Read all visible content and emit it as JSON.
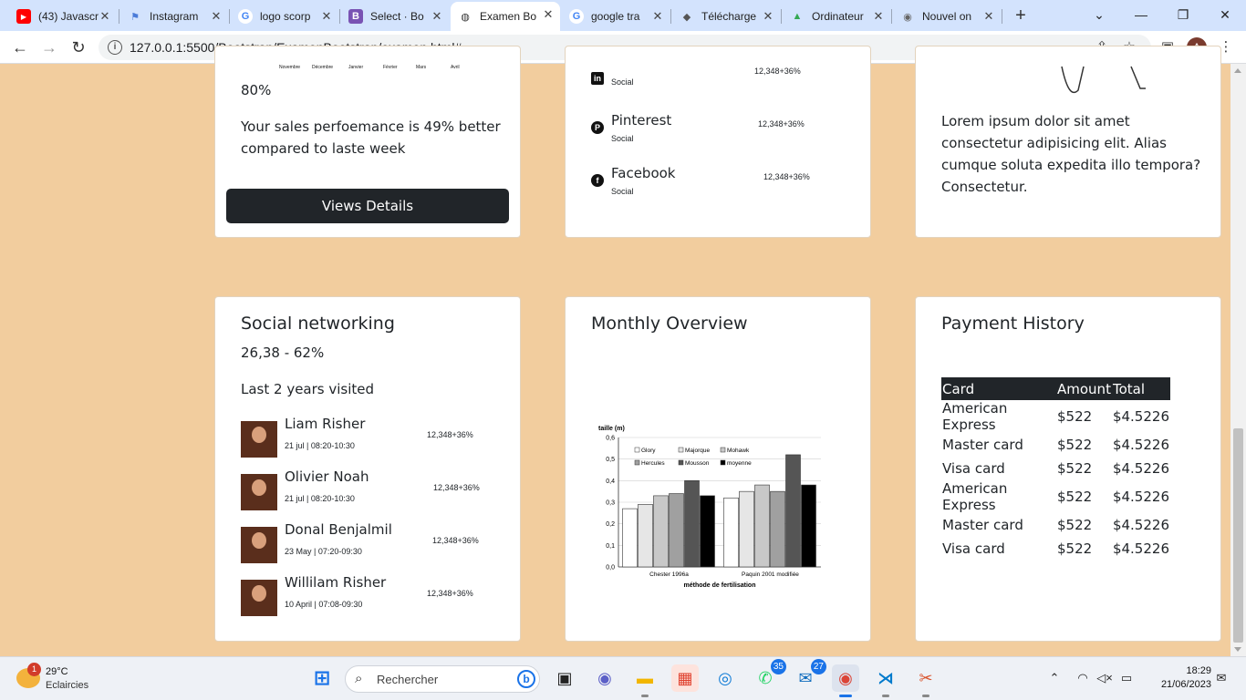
{
  "browser": {
    "tabs": [
      {
        "label": "(43) Javascr",
        "icon": "youtube-icon",
        "color": "#ff0000",
        "glyph": "▶"
      },
      {
        "label": "Instagram",
        "icon": "flag-icon",
        "color": "#4a7bd8",
        "glyph": "⚑"
      },
      {
        "label": "logo scorp",
        "icon": "google-icon",
        "color": "#4285f4",
        "glyph": "G"
      },
      {
        "label": "Select · Bo",
        "icon": "bootstrap-icon",
        "color": "#7952b3",
        "glyph": "B"
      },
      {
        "label": "Examen Bo",
        "icon": "globe-icon",
        "color": "#333333",
        "glyph": "◍",
        "active": true
      },
      {
        "label": "google tra",
        "icon": "google-icon",
        "color": "#4285f4",
        "glyph": "G"
      },
      {
        "label": "Télécharge",
        "icon": "diamond-icon",
        "color": "#555555",
        "glyph": "◆"
      },
      {
        "label": "Ordinateur",
        "icon": "drive-icon",
        "color": "#34a853",
        "glyph": "▲"
      },
      {
        "label": "Nouvel on",
        "icon": "chrome-icon",
        "color": "#666666",
        "glyph": "◉"
      }
    ],
    "url": "127.0.0.1:5500/Bootstrap/ExamenBootstrap/examen.html#",
    "profile_initial": "A"
  },
  "top_left_card": {
    "chart_months": [
      "Novembre",
      "Décembre",
      "Janvier",
      "Février",
      "Mars",
      "Avril"
    ],
    "percent": "80%",
    "sales_text": "Your sales perfoemance is 49% better compared to laste week",
    "button_label": "Views Details"
  },
  "top_mid_card": {
    "rows": [
      {
        "name": "",
        "sub": "Social",
        "value": "12,348+36%",
        "icon": "linkedin-icon",
        "glyph": "in"
      },
      {
        "name": "Pinterest",
        "sub": "Social",
        "value": "12,348+36%",
        "icon": "pinterest-icon",
        "glyph": "P"
      },
      {
        "name": "Facebook",
        "sub": "Social",
        "value": "12,348+36%",
        "icon": "facebook-icon",
        "glyph": "f"
      }
    ]
  },
  "top_right_card": {
    "text": "Lorem ipsum dolor sit amet consectetur adipisicing elit. Alias cumque soluta expedita illo tempora? Consectetur."
  },
  "social_card": {
    "title": "Social networking",
    "stat": "26,38 - 62%",
    "subtitle": "Last 2 years visited",
    "people": [
      {
        "name": "Liam Risher",
        "date": "21 jul | 08:20-10:30",
        "value": "12,348+36%"
      },
      {
        "name": "Olivier Noah",
        "date": "21 jul | 08:20-10:30",
        "value": "12,348+36%"
      },
      {
        "name": "Donal Benjalmil",
        "date": "23 May | 07:20-09:30",
        "value": "12,348+36%"
      },
      {
        "name": "Willilam Risher",
        "date": "10 April | 07:08-09:30",
        "value": "12,348+36%"
      }
    ]
  },
  "monthly_card": {
    "title": "Monthly Overview"
  },
  "chart_data": {
    "type": "bar",
    "ylabel": "taille (m)",
    "xlabel": "méthode de fertilisation",
    "categories": [
      "Chester 1996a",
      "Paquin 2001 modifiée"
    ],
    "ylim": [
      0,
      0.6
    ],
    "yticks": [
      "0,0",
      "0,1",
      "0,2",
      "0,3",
      "0,4",
      "0,5",
      "0,6"
    ],
    "series": [
      {
        "name": "Glory",
        "values": [
          0.27,
          0.32
        ],
        "color": "#ffffff"
      },
      {
        "name": "Majorque",
        "values": [
          0.29,
          0.35
        ],
        "color": "#e6e6e6"
      },
      {
        "name": "Mohawk",
        "values": [
          0.33,
          0.38
        ],
        "color": "#c8c8c8"
      },
      {
        "name": "Hercules",
        "values": [
          0.34,
          0.35
        ],
        "color": "#a0a0a0"
      },
      {
        "name": "Mousson",
        "values": [
          0.4,
          0.52
        ],
        "color": "#555555"
      },
      {
        "name": "moyenne",
        "values": [
          0.33,
          0.38
        ],
        "color": "#000000"
      }
    ],
    "legend_position": "top-left"
  },
  "payment_card": {
    "title": "Payment History",
    "headers": [
      "Card",
      "Amount",
      "Total"
    ],
    "rows": [
      [
        "American Express",
        "$522",
        "$4.5226"
      ],
      [
        "Master card",
        "$522",
        "$4.5226"
      ],
      [
        "Visa card",
        "$522",
        "$4.5226"
      ],
      [
        "American Express",
        "$522",
        "$4.5226"
      ],
      [
        "Master card",
        "$522",
        "$4.5226"
      ],
      [
        "Visa card",
        "$522",
        "$4.5226"
      ]
    ]
  },
  "taskbar": {
    "weather_temp": "29°C",
    "weather_desc": "Eclaircies",
    "weather_badge": "1",
    "search_placeholder": "Rechercher",
    "whatsapp_badge": "35",
    "mail_badge": "27",
    "time": "18:29",
    "date": "21/06/2023"
  }
}
